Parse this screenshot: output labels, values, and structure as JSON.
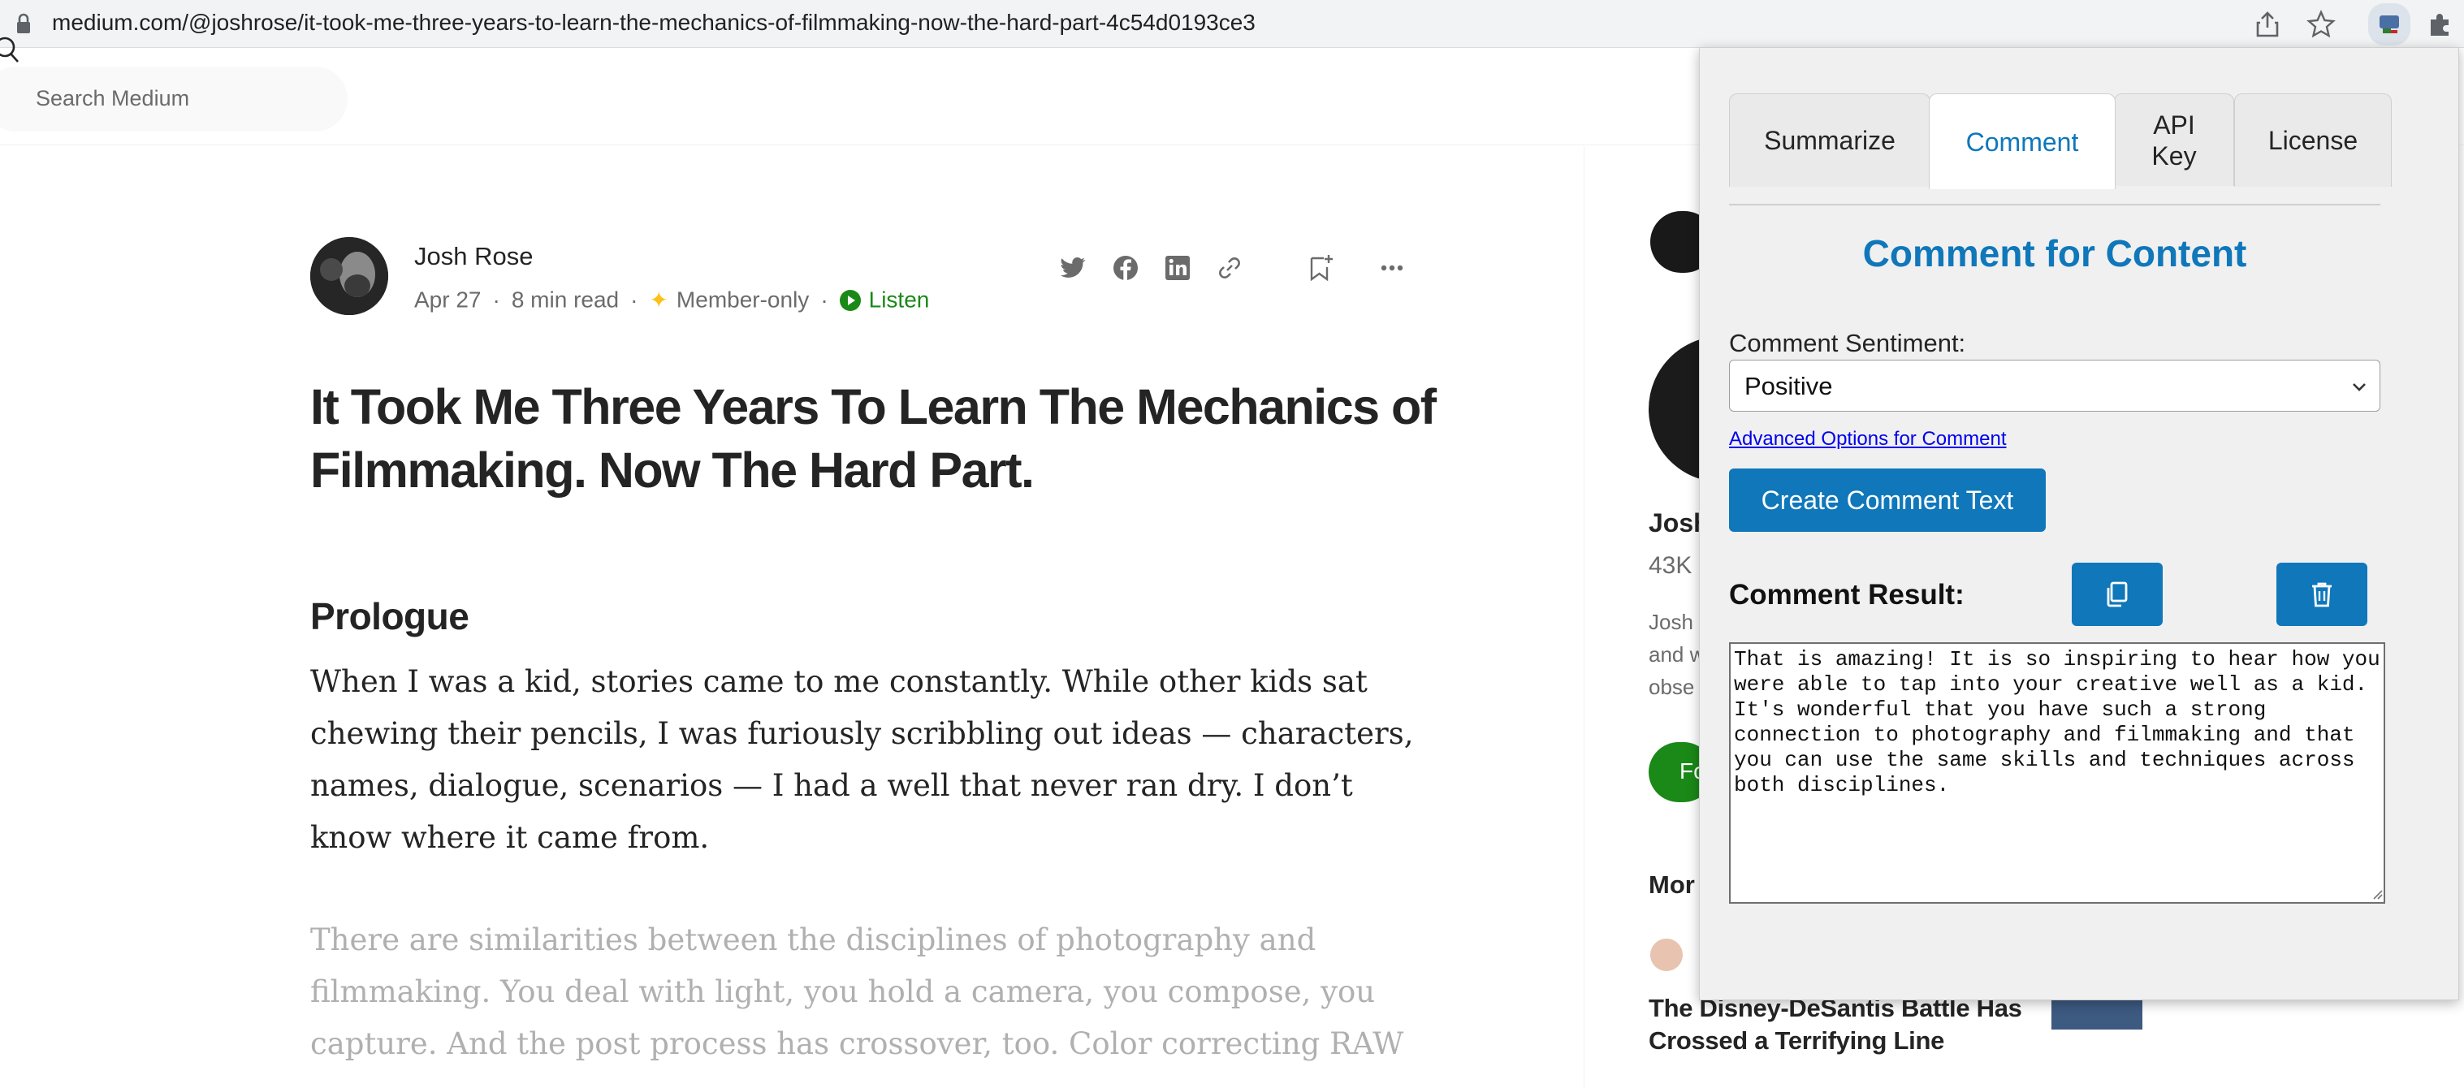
{
  "browser": {
    "url": "medium.com/@joshrose/it-took-me-three-years-to-learn-the-mechanics-of-filmmaking-now-the-hard-part-4c54d0193ce3",
    "icons": [
      "lock-icon",
      "share-icon",
      "bookmark-star-icon",
      "extension-active-icon",
      "extensions-puzzle-icon"
    ]
  },
  "header": {
    "search_placeholder": "Search Medium"
  },
  "article": {
    "author": "Josh Rose",
    "date": "Apr 27",
    "read_time": "8 min read",
    "member_only": "Member-only",
    "listen": "Listen",
    "title": "It Took Me Three Years To Learn The Mechanics of Filmmaking. Now The Hard Part.",
    "section_heading": "Prologue",
    "paragraph_1": "When I was a kid, stories came to me constantly. While other kids sat chewing their pencils, I was furiously scribbling out ideas — characters, names, dialogue, scenarios — I had a well that never ran dry. I don’t know where it came from.",
    "paragraph_2": "There are similarities between the disciplines of photography and filmmaking. You deal with light, you hold a camera, you compose, you capture. And the post process has crossover, too. Color correcting RAW"
  },
  "right_column": {
    "name_partial": "Josh",
    "followers_partial": "43K",
    "bio_lines": [
      "Josh",
      "and w",
      "obse"
    ],
    "follow_partial": "Fo",
    "more_partial": "Mor",
    "story_title": "The Disney-DeSantis Battle Has Crossed a Terrifying Line"
  },
  "popup": {
    "tabs": [
      "Summarize",
      "Comment",
      "API Key",
      "License"
    ],
    "active_tab": "Comment",
    "title": "Comment for Content",
    "sentiment_label": "Comment Sentiment:",
    "sentiment_value": "Positive",
    "advanced_link": "Advanced Options for Comment",
    "create_button": "Create Comment Text",
    "result_label": "Comment Result:",
    "result_text": "That is amazing! It is so inspiring to hear how you were able to tap into your creative well as a kid. It's wonderful that you have such a strong connection to photography and filmmaking and that you can use the same skills and techniques across both disciplines.",
    "accent_color": "#0f77ba"
  }
}
